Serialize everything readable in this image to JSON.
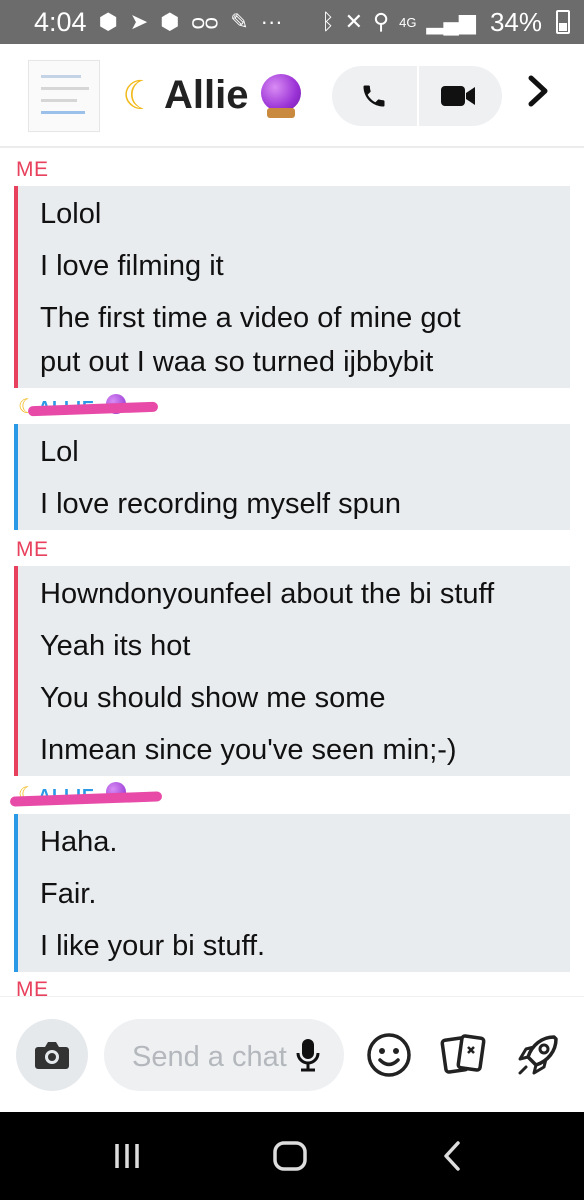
{
  "status_bar": {
    "time": "4:04",
    "battery": "34%",
    "network": "4G"
  },
  "header": {
    "contact_name": "Allie",
    "icons": [
      "moon-emoji",
      "crystal-ball-emoji",
      "phone-icon",
      "video-icon",
      "chevron-right-icon"
    ]
  },
  "chat": {
    "me_label": "ME",
    "her_label": "ALLIE",
    "blocks": [
      {
        "sender": "me",
        "lines": [
          "Lolol",
          "I love filming it",
          "The first time a video of mine got",
          "put out I waa so turned ijbbybit"
        ]
      },
      {
        "sender": "her",
        "lines": [
          "Lol",
          "I love recording myself spun"
        ]
      },
      {
        "sender": "me",
        "lines": [
          "Howndonyounfeel about the bi stuff",
          "Yeah its hot",
          "You should show me some",
          "Inmean since you've seen min;-)"
        ]
      },
      {
        "sender": "her",
        "lines": [
          "Haha.",
          "Fair.",
          "I like your bi stuff."
        ]
      }
    ],
    "trailing_label": "ME"
  },
  "composer": {
    "placeholder": "Send a chat"
  },
  "colors": {
    "me": "#e8415d",
    "her": "#2a9ae6",
    "bubble_bg": "#e9ecef",
    "status_bar": "#6c6c6c"
  }
}
